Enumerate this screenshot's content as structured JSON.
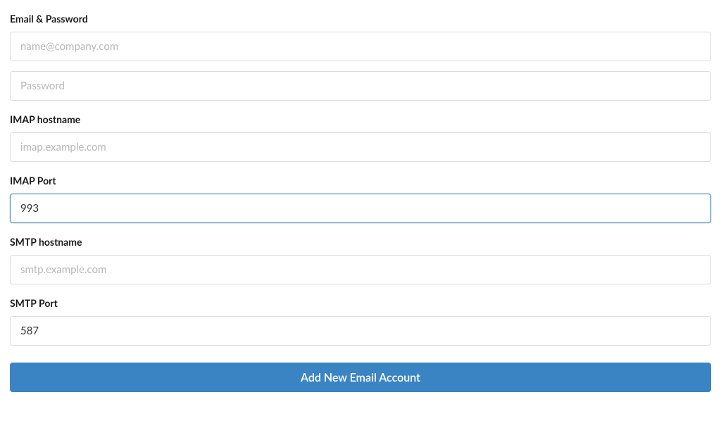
{
  "form": {
    "emailPassword": {
      "label": "Email & Password",
      "emailPlaceholder": "name@company.com",
      "emailValue": "",
      "passwordPlaceholder": "Password",
      "passwordValue": ""
    },
    "imapHostname": {
      "label": "IMAP hostname",
      "placeholder": "imap.example.com",
      "value": ""
    },
    "imapPort": {
      "label": "IMAP Port",
      "placeholder": "",
      "value": "993"
    },
    "smtpHostname": {
      "label": "SMTP hostname",
      "placeholder": "smtp.example.com",
      "value": ""
    },
    "smtpPort": {
      "label": "SMTP Port",
      "placeholder": "",
      "value": "587"
    },
    "submitLabel": "Add New Email Account"
  }
}
